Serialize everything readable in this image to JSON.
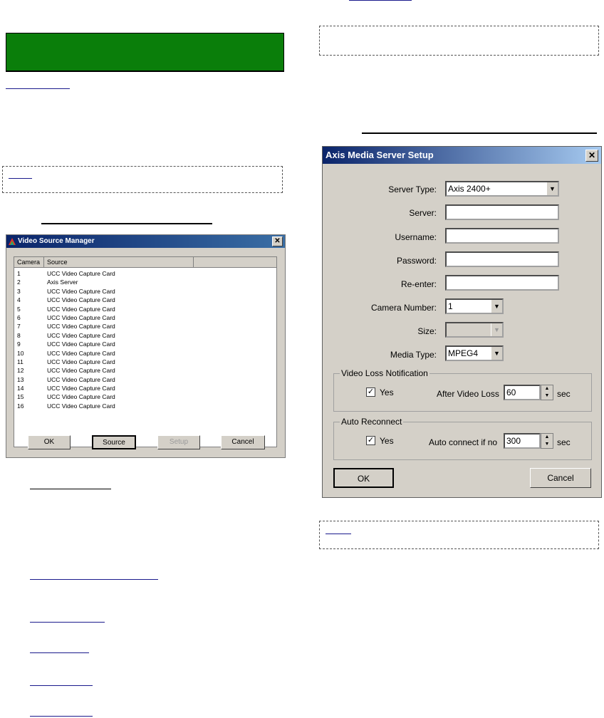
{
  "video_source_manager": {
    "title": "Video Source Manager",
    "columns": [
      "Camera",
      "Source"
    ],
    "rows": [
      {
        "camera": "1",
        "source": "UCC Video Capture Card"
      },
      {
        "camera": "2",
        "source": "Axis Server"
      },
      {
        "camera": "3",
        "source": "UCC Video Capture Card"
      },
      {
        "camera": "4",
        "source": "UCC Video Capture Card"
      },
      {
        "camera": "5",
        "source": "UCC Video Capture Card"
      },
      {
        "camera": "6",
        "source": "UCC Video Capture Card"
      },
      {
        "camera": "7",
        "source": "UCC Video Capture Card"
      },
      {
        "camera": "8",
        "source": "UCC Video Capture Card"
      },
      {
        "camera": "9",
        "source": "UCC Video Capture Card"
      },
      {
        "camera": "10",
        "source": "UCC Video Capture Card"
      },
      {
        "camera": "11",
        "source": "UCC Video Capture Card"
      },
      {
        "camera": "12",
        "source": "UCC Video Capture Card"
      },
      {
        "camera": "13",
        "source": "UCC Video Capture Card"
      },
      {
        "camera": "14",
        "source": "UCC Video Capture Card"
      },
      {
        "camera": "15",
        "source": "UCC Video Capture Card"
      },
      {
        "camera": "16",
        "source": "UCC Video Capture Card"
      }
    ],
    "buttons": {
      "ok": "OK",
      "source": "Source",
      "setup": "Setup",
      "cancel": "Cancel"
    }
  },
  "axis_dialog": {
    "title": "Axis Media Server Setup",
    "labels": {
      "server_type": "Server Type:",
      "server": "Server:",
      "username": "Username:",
      "password": "Password:",
      "reenter": "Re-enter:",
      "camera_number": "Camera Number:",
      "size": "Size:",
      "media_type": "Media Type:"
    },
    "values": {
      "server_type": "Axis 2400+",
      "server": "",
      "username": "",
      "password": "",
      "reenter": "",
      "camera_number": "1",
      "size": "",
      "media_type": "MPEG4"
    },
    "video_loss": {
      "legend": "Video Loss Notification",
      "yes_label": "Yes",
      "checked": true,
      "after_label": "After Video Loss",
      "value": "60",
      "unit": "sec"
    },
    "auto_reconnect": {
      "legend": "Auto Reconnect",
      "yes_label": "Yes",
      "checked": true,
      "after_label": "Auto connect if no",
      "value": "300",
      "unit": "sec"
    },
    "buttons": {
      "ok": "OK",
      "cancel": "Cancel"
    }
  },
  "glyphs": {
    "close": "✕",
    "dropdown": "▼",
    "check": "✓",
    "spin_up": "▲",
    "spin_down": "▼"
  }
}
